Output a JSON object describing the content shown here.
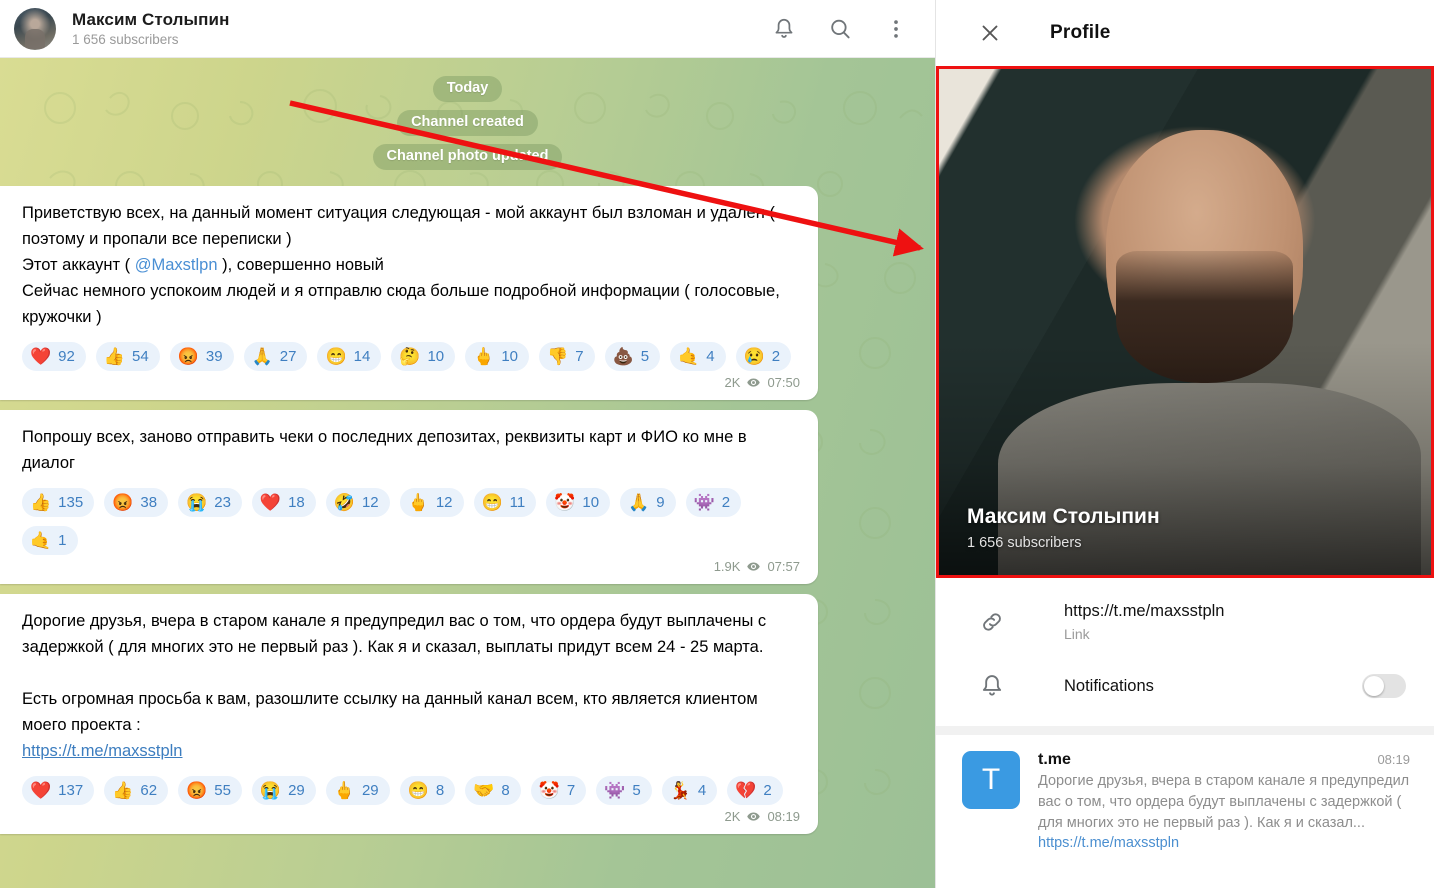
{
  "chat_header": {
    "title": "Максим Столыпин",
    "subtitle": "1 656 subscribers",
    "avatar_name": "channel-avatar",
    "icons": {
      "mute": "bell-icon",
      "search": "search-icon",
      "more": "more-vertical-icon"
    }
  },
  "service_messages": [
    "Today",
    "Channel created",
    "Channel photo updated"
  ],
  "messages": [
    {
      "lines": [
        "Приветствую всех, на данный момент ситуация следующая - мой аккаунт был взломан и удален ( поэтому и пропали все переписки )",
        "Этот аккаунт ( @Maxstlpn ), совершенно новый",
        "Сейчас немного успокоим людей и я отправлю сюда больше подробной информации ( голосовые, кружочки )"
      ],
      "mention": "@Maxstlpn",
      "reactions": [
        {
          "emoji": "❤️",
          "name": "red-heart",
          "count": "92"
        },
        {
          "emoji": "👍",
          "name": "thumbs-up",
          "count": "54"
        },
        {
          "emoji": "😡",
          "name": "angry-face",
          "count": "39"
        },
        {
          "emoji": "🙏",
          "name": "folded-hands",
          "count": "27"
        },
        {
          "emoji": "😁",
          "name": "grinning-face",
          "count": "14"
        },
        {
          "emoji": "🤔",
          "name": "thinking-face",
          "count": "10"
        },
        {
          "emoji": "🖕",
          "name": "middle-finger",
          "count": "10"
        },
        {
          "emoji": "👎",
          "name": "thumbs-down",
          "count": "7"
        },
        {
          "emoji": "💩",
          "name": "pile-of-poo",
          "count": "5"
        },
        {
          "emoji": "🤙",
          "name": "call-me-hand",
          "count": "4"
        },
        {
          "emoji": "😢",
          "name": "crying-face",
          "count": "2"
        }
      ],
      "views": "2K",
      "time": "07:50"
    },
    {
      "lines": [
        "Попрошу всех, заново отправить чеки о последних депозитах, реквизиты карт и ФИО ко мне в диалог"
      ],
      "reactions": [
        {
          "emoji": "👍",
          "name": "thumbs-up",
          "count": "135"
        },
        {
          "emoji": "😡",
          "name": "angry-face",
          "count": "38"
        },
        {
          "emoji": "😭",
          "name": "loudly-crying-face",
          "count": "23"
        },
        {
          "emoji": "❤️",
          "name": "red-heart",
          "count": "18"
        },
        {
          "emoji": "🤣",
          "name": "rolling-on-floor-laughing",
          "count": "12"
        },
        {
          "emoji": "🖕",
          "name": "middle-finger",
          "count": "12"
        },
        {
          "emoji": "😁",
          "name": "grinning-face",
          "count": "11"
        },
        {
          "emoji": "🤡",
          "name": "clown-face",
          "count": "10"
        },
        {
          "emoji": "🙏",
          "name": "folded-hands",
          "count": "9"
        },
        {
          "emoji": "👾",
          "name": "alien-monster",
          "count": "2"
        },
        {
          "emoji": "🤙",
          "name": "call-me-hand",
          "count": "1"
        }
      ],
      "views": "1.9K",
      "time": "07:57"
    },
    {
      "lines": [
        "Дорогие друзья, вчера в старом канале я предупредил вас о том, что ордера будут выплачены с задержкой ( для многих это не первый раз ). Как я и сказал, выплаты придут всем 24 - 25 марта.",
        "",
        "Есть огромная просьба к вам, разошлите ссылку на данный канал всем, кто является клиентом моего проекта :"
      ],
      "link": "https://t.me/maxsstpln",
      "reactions": [
        {
          "emoji": "❤️",
          "name": "red-heart",
          "count": "137"
        },
        {
          "emoji": "👍",
          "name": "thumbs-up",
          "count": "62"
        },
        {
          "emoji": "😡",
          "name": "angry-face",
          "count": "55"
        },
        {
          "emoji": "😭",
          "name": "loudly-crying-face",
          "count": "29"
        },
        {
          "emoji": "🖕",
          "name": "middle-finger",
          "count": "29"
        },
        {
          "emoji": "😁",
          "name": "grinning-face",
          "count": "8"
        },
        {
          "emoji": "🤝",
          "name": "handshake",
          "count": "8"
        },
        {
          "emoji": "🤡",
          "name": "clown-face",
          "count": "7"
        },
        {
          "emoji": "👾",
          "name": "alien-monster",
          "count": "5"
        },
        {
          "emoji": "💃",
          "name": "dancer",
          "count": "4"
        },
        {
          "emoji": "💔",
          "name": "broken-heart",
          "count": "2"
        }
      ],
      "views": "2K",
      "time": "08:19"
    }
  ],
  "profile": {
    "header_title": "Profile",
    "close_icon": "close-icon",
    "photo_name": "Максим Столыпин",
    "photo_subscribers": "1 656 subscribers",
    "rows": [
      {
        "icon": "link-icon",
        "main": "https://t.me/maxsstpln",
        "secondary": "Link"
      },
      {
        "icon": "bell-icon",
        "main": "Notifications",
        "toggle": "off"
      }
    ],
    "shared": {
      "tile_letter": "T",
      "title": "t.me",
      "time": "08:19",
      "description": "Дорогие друзья, вчера в старом канале я предупредил вас о том, что ордера будут выплачены с задержкой ( для многих это не первый раз ). Как я и сказал...",
      "link": "https://t.me/maxsstpln"
    }
  },
  "annotation": {
    "arrow_color": "#ee1111",
    "highlight_color": "#ee1111"
  }
}
